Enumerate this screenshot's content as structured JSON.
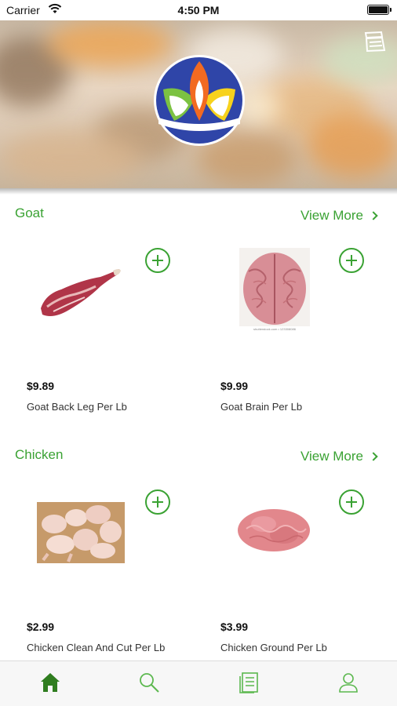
{
  "status_bar": {
    "carrier": "Carrier",
    "time": "4:50 PM"
  },
  "header": {
    "menu_icon": "menu-icon",
    "logo": "brand-lotus-logo"
  },
  "sections": [
    {
      "title": "Goat",
      "view_more": "View More",
      "products": [
        {
          "price": "$9.89",
          "name": "Goat Back Leg Per Lb"
        },
        {
          "price": "$9.99",
          "name": "Goat Brain Per Lb",
          "image_caption": "shutterstock.com • 123308086"
        }
      ]
    },
    {
      "title": "Chicken",
      "view_more": "View More",
      "products": [
        {
          "price": "$2.99",
          "name": "Chicken Clean And Cut Per Lb"
        },
        {
          "price": "$3.99",
          "name": "Chicken Ground Per Lb"
        }
      ]
    }
  ],
  "tab_bar": {
    "tabs": [
      "home-icon",
      "search-icon",
      "orders-icon",
      "profile-icon"
    ],
    "active_color": "#2f7d1f",
    "inactive_color": "#5cb84f"
  },
  "colors": {
    "accent": "#3aa233"
  }
}
